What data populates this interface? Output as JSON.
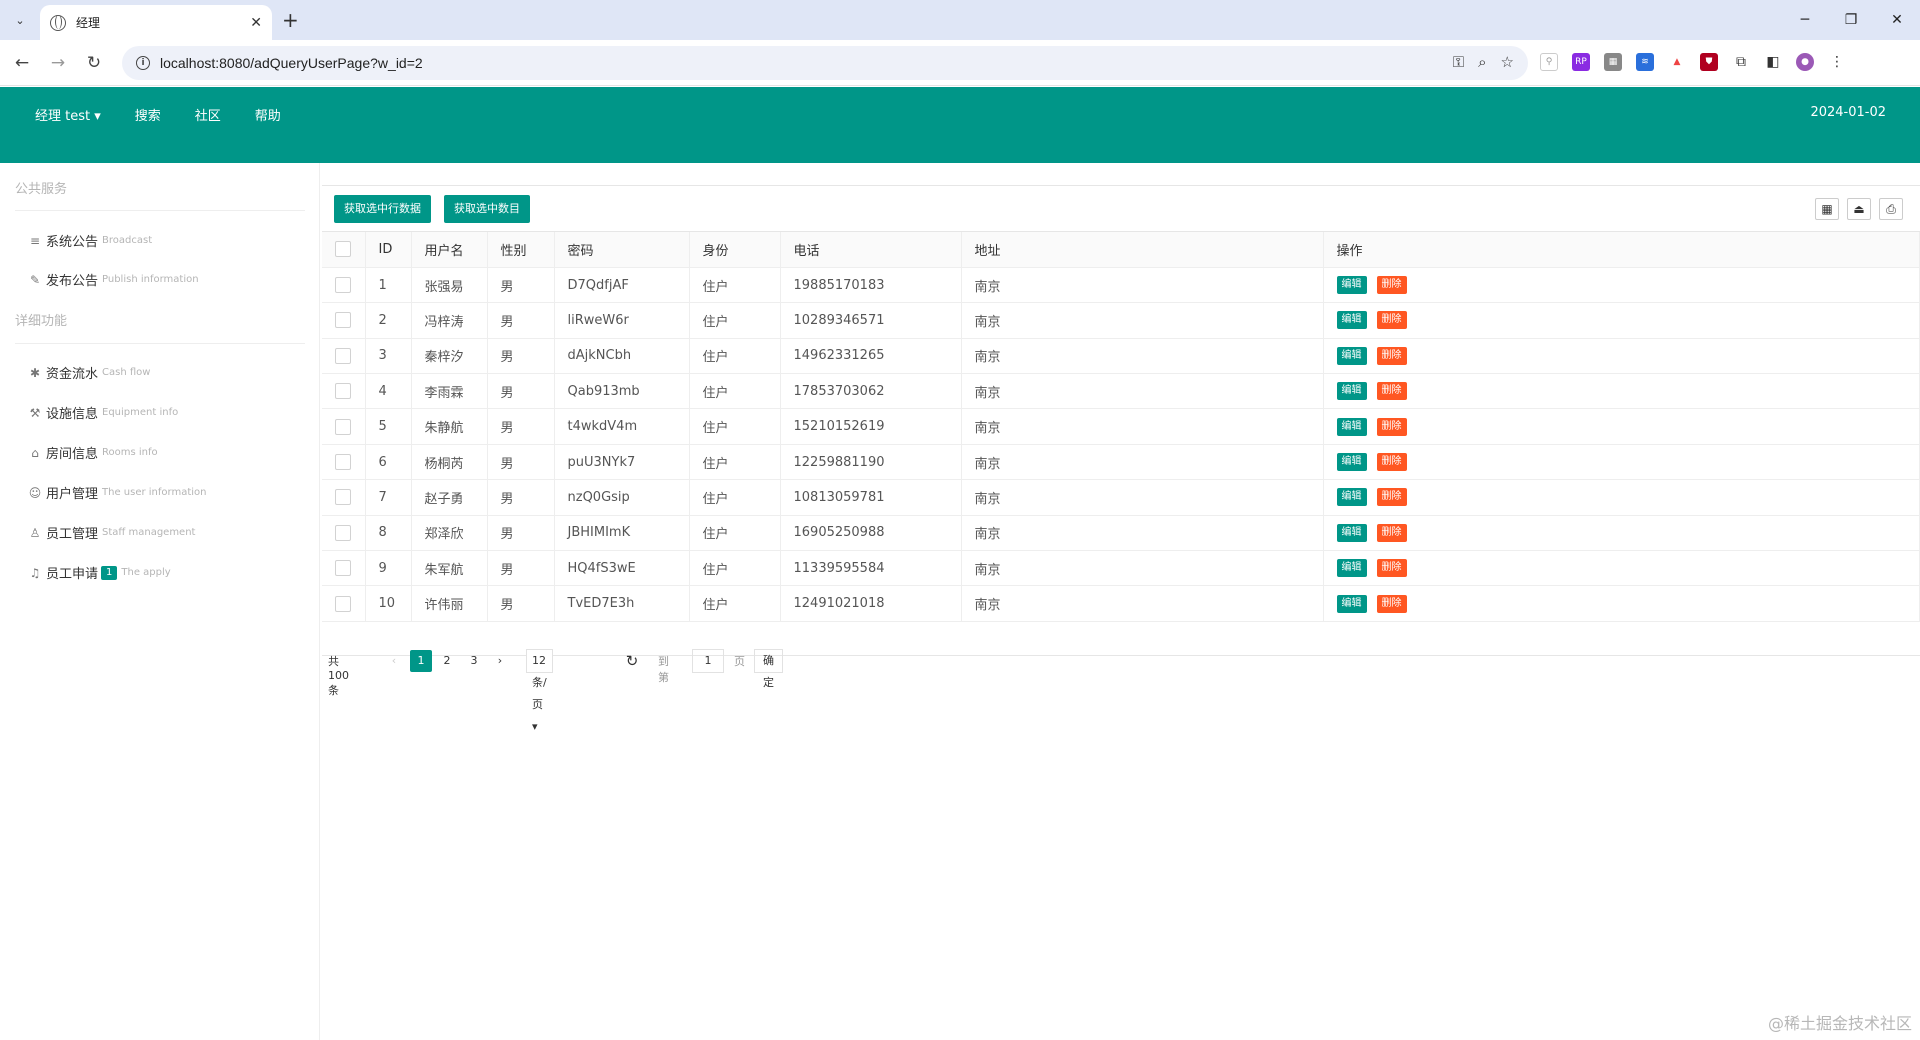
{
  "browser": {
    "tab_title": "经理",
    "url": "localhost:8080/adQueryUserPage?w_id=2"
  },
  "header": {
    "nav": [
      {
        "label": "经理 test ▾"
      },
      {
        "label": "搜索"
      },
      {
        "label": "社区"
      },
      {
        "label": "帮助"
      }
    ],
    "date": "2024-01-02",
    "accent_color": "#009688"
  },
  "sidebar": {
    "group_public": "公共服务",
    "public_items": [
      {
        "label": "系统公告",
        "en": "Broadcast",
        "icon": "list-icon"
      },
      {
        "label": "发布公告",
        "en": "Publish information",
        "icon": "edit-icon"
      }
    ],
    "group_detail": "详细功能",
    "detail_items": [
      {
        "label": "资金流水",
        "en": "Cash flow",
        "icon": "gear-icon"
      },
      {
        "label": "设施信息",
        "en": "Equipment info",
        "icon": "tools-icon"
      },
      {
        "label": "房间信息",
        "en": "Rooms info",
        "icon": "home-icon"
      },
      {
        "label": "用户管理",
        "en": "The user information",
        "icon": "users-icon"
      },
      {
        "label": "员工管理",
        "en": "Staff management",
        "icon": "user-icon"
      },
      {
        "label": "员工申请",
        "en": "The apply",
        "icon": "bell-icon",
        "badge": "1"
      }
    ]
  },
  "toolbar": {
    "get_rows_label": "获取选中行数据",
    "get_count_label": "获取选中数目"
  },
  "table": {
    "columns": [
      "ID",
      "用户名",
      "性别",
      "密码",
      "身份",
      "电话",
      "地址",
      "操作"
    ],
    "edit_label": "编辑",
    "delete_label": "删除",
    "rows": [
      {
        "id": "1",
        "name": "张强易",
        "sex": "男",
        "pwd": "D7QdfjAF",
        "role": "住户",
        "phone": "19885170183",
        "addr": "南京"
      },
      {
        "id": "2",
        "name": "冯梓涛",
        "sex": "男",
        "pwd": "liRweW6r",
        "role": "住户",
        "phone": "10289346571",
        "addr": "南京"
      },
      {
        "id": "3",
        "name": "秦梓汐",
        "sex": "男",
        "pwd": "dAjkNCbh",
        "role": "住户",
        "phone": "14962331265",
        "addr": "南京"
      },
      {
        "id": "4",
        "name": "李雨霖",
        "sex": "男",
        "pwd": "Qab913mb",
        "role": "住户",
        "phone": "17853703062",
        "addr": "南京"
      },
      {
        "id": "5",
        "name": "朱静航",
        "sex": "男",
        "pwd": "t4wkdV4m",
        "role": "住户",
        "phone": "15210152619",
        "addr": "南京"
      },
      {
        "id": "6",
        "name": "杨桐芮",
        "sex": "男",
        "pwd": "puU3NYk7",
        "role": "住户",
        "phone": "12259881190",
        "addr": "南京"
      },
      {
        "id": "7",
        "name": "赵子勇",
        "sex": "男",
        "pwd": "nzQ0Gsip",
        "role": "住户",
        "phone": "10813059781",
        "addr": "南京"
      },
      {
        "id": "8",
        "name": "郑泽欣",
        "sex": "男",
        "pwd": "JBHIMImK",
        "role": "住户",
        "phone": "16905250988",
        "addr": "南京"
      },
      {
        "id": "9",
        "name": "朱军航",
        "sex": "男",
        "pwd": "HQ4fS3wE",
        "role": "住户",
        "phone": "11339595584",
        "addr": "南京"
      },
      {
        "id": "10",
        "name": "许伟丽",
        "sex": "男",
        "pwd": "TvED7E3h",
        "role": "住户",
        "phone": "12491021018",
        "addr": "南京"
      }
    ]
  },
  "pager": {
    "count": "共 100 条",
    "pages": [
      "1",
      "2",
      "3"
    ],
    "per_page": "12 条/页 ▾",
    "goto_label": "到第",
    "goto_value": "1",
    "page_label": "页",
    "confirm_label": "确定"
  },
  "watermark": "@稀土掘金技术社区"
}
